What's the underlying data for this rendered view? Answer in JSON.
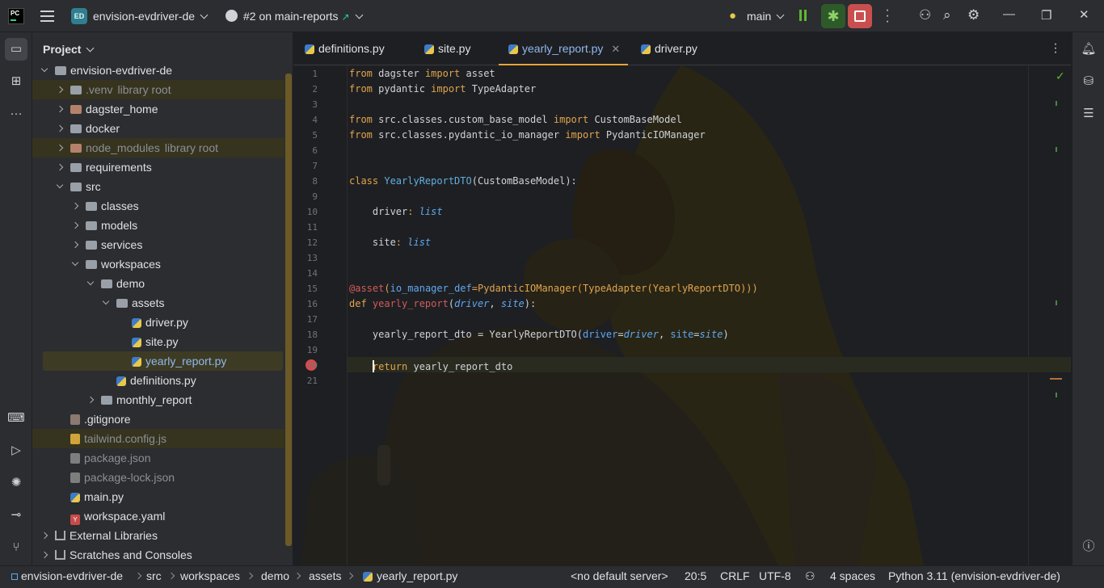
{
  "topbar": {
    "ide_logo": "PC",
    "project_badge": "ED",
    "project_name": "envision-evdriver-de",
    "pr_label": "#2 on main-reports",
    "branch": "main"
  },
  "project_panel": {
    "title": "Project",
    "tree": [
      {
        "label": "envision-evdriver-de",
        "kind": "folder",
        "depth": 0,
        "open": true
      },
      {
        "label": ".venv",
        "suffix": "library root",
        "kind": "folder",
        "depth": 1,
        "open": false,
        "muted": true
      },
      {
        "label": "dagster_home",
        "kind": "folder-excluded",
        "depth": 1,
        "open": false
      },
      {
        "label": "docker",
        "kind": "folder",
        "depth": 1,
        "open": false
      },
      {
        "label": "node_modules",
        "suffix": "library root",
        "kind": "folder-excluded",
        "depth": 1,
        "open": false,
        "muted": true
      },
      {
        "label": "requirements",
        "kind": "folder",
        "depth": 1,
        "open": false
      },
      {
        "label": "src",
        "kind": "folder",
        "depth": 1,
        "open": true
      },
      {
        "label": "classes",
        "kind": "folder",
        "depth": 2,
        "open": false
      },
      {
        "label": "models",
        "kind": "folder",
        "depth": 2,
        "open": false
      },
      {
        "label": "services",
        "kind": "folder",
        "depth": 2,
        "open": false
      },
      {
        "label": "workspaces",
        "kind": "folder",
        "depth": 2,
        "open": true
      },
      {
        "label": "demo",
        "kind": "folder",
        "depth": 3,
        "open": true
      },
      {
        "label": "assets",
        "kind": "folder",
        "depth": 4,
        "open": true
      },
      {
        "label": "driver.py",
        "kind": "py",
        "depth": 5
      },
      {
        "label": "site.py",
        "kind": "py",
        "depth": 5
      },
      {
        "label": "yearly_report.py",
        "kind": "py",
        "depth": 5,
        "selected": true
      },
      {
        "label": "definitions.py",
        "kind": "py",
        "depth": 4
      },
      {
        "label": "monthly_report",
        "kind": "folder",
        "depth": 3,
        "open": false
      },
      {
        "label": ".gitignore",
        "kind": "git",
        "depth": 1
      },
      {
        "label": "tailwind.config.js",
        "kind": "js",
        "depth": 1,
        "muted": true
      },
      {
        "label": "package.json",
        "kind": "json",
        "depth": 1,
        "muted": true
      },
      {
        "label": "package-lock.json",
        "kind": "json",
        "depth": 1,
        "muted": true
      },
      {
        "label": "main.py",
        "kind": "py",
        "depth": 1
      },
      {
        "label": "workspace.yaml",
        "kind": "yaml",
        "depth": 1
      },
      {
        "label": "External Libraries",
        "kind": "lib",
        "depth": 0,
        "open": false
      },
      {
        "label": "Scratches and Consoles",
        "kind": "scratch",
        "depth": 0,
        "open": false
      }
    ]
  },
  "tabs": [
    {
      "label": "definitions.py",
      "active": false
    },
    {
      "label": "site.py",
      "active": false
    },
    {
      "label": "yearly_report.py",
      "active": true
    },
    {
      "label": "driver.py",
      "active": false
    }
  ],
  "editor": {
    "lines": [
      "1",
      "2",
      "3",
      "4",
      "5",
      "6",
      "7",
      "8",
      "9",
      "10",
      "11",
      "12",
      "13",
      "14",
      "15",
      "16",
      "17",
      "18",
      "19",
      "20",
      "21"
    ],
    "code": {
      "l1": "from dagster import asset",
      "l2": "from pydantic import TypeAdapter",
      "l4": "from src.classes.custom_base_model import CustomBaseModel",
      "l5": "from src.classes.pydantic_io_manager import PydanticIOManager",
      "l8a": "class ",
      "l8b": "YearlyReportDTO",
      "l8c": "(CustomBaseModel):",
      "l10a": "    driver",
      "l10b": ": ",
      "l10c": "list",
      "l12a": "    site",
      "l12b": ": ",
      "l12c": "list",
      "l15a": "@asset",
      "l15b": "(",
      "l15c": "io_manager_def",
      "l15d": "=PydanticIOManager(TypeAdapter(YearlyReportDTO)))",
      "l16a": "def ",
      "l16b": "yearly_report",
      "l16c": "(",
      "l16d": "driver",
      "l16e": ", ",
      "l16f": "site",
      "l16g": "):",
      "l18a": "    yearly_report_dto = YearlyReportDTO(",
      "l18b": "driver",
      "l18c": "=",
      "l18d": "driver",
      "l18e": ", ",
      "l18f": "site",
      "l18g": "=",
      "l18h": "site",
      "l18i": ")",
      "l20a": "return",
      "l20b": " yearly_report_dto"
    }
  },
  "statusbar": {
    "breadcrumbs": [
      "envision-evdriver-de",
      "src",
      "workspaces",
      "demo",
      "assets",
      "yearly_report.py"
    ],
    "server": "<no default server>",
    "position": "20:5",
    "line_sep": "CRLF",
    "encoding": "UTF-8",
    "indent": "4 spaces",
    "interpreter": "Python 3.11 (envision-evdriver-de)"
  }
}
